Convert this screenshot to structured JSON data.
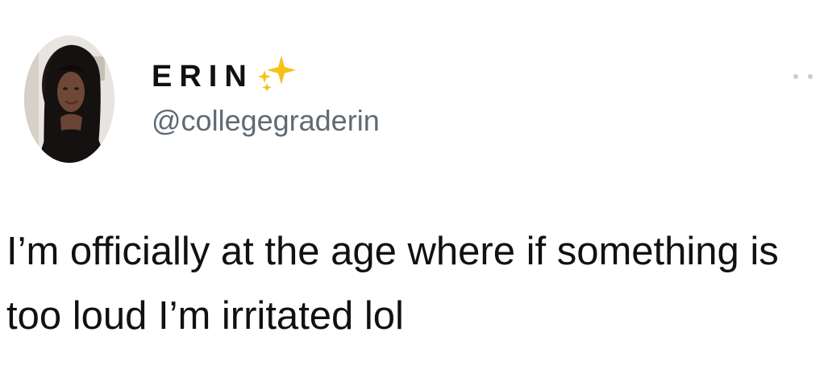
{
  "tweet": {
    "author": {
      "display_name": "ERIN",
      "handle": "@collegegraderin",
      "avatar_icon": "profile-photo"
    },
    "badge_icon": "sparkles",
    "text": "I’m officially at the age where if something is too loud I’m irritated lol",
    "menu_icon": "more-options",
    "colors": {
      "sparkle": "#f6c21a",
      "handle": "#5f6a74",
      "text": "#111111",
      "background": "#ffffff"
    }
  }
}
